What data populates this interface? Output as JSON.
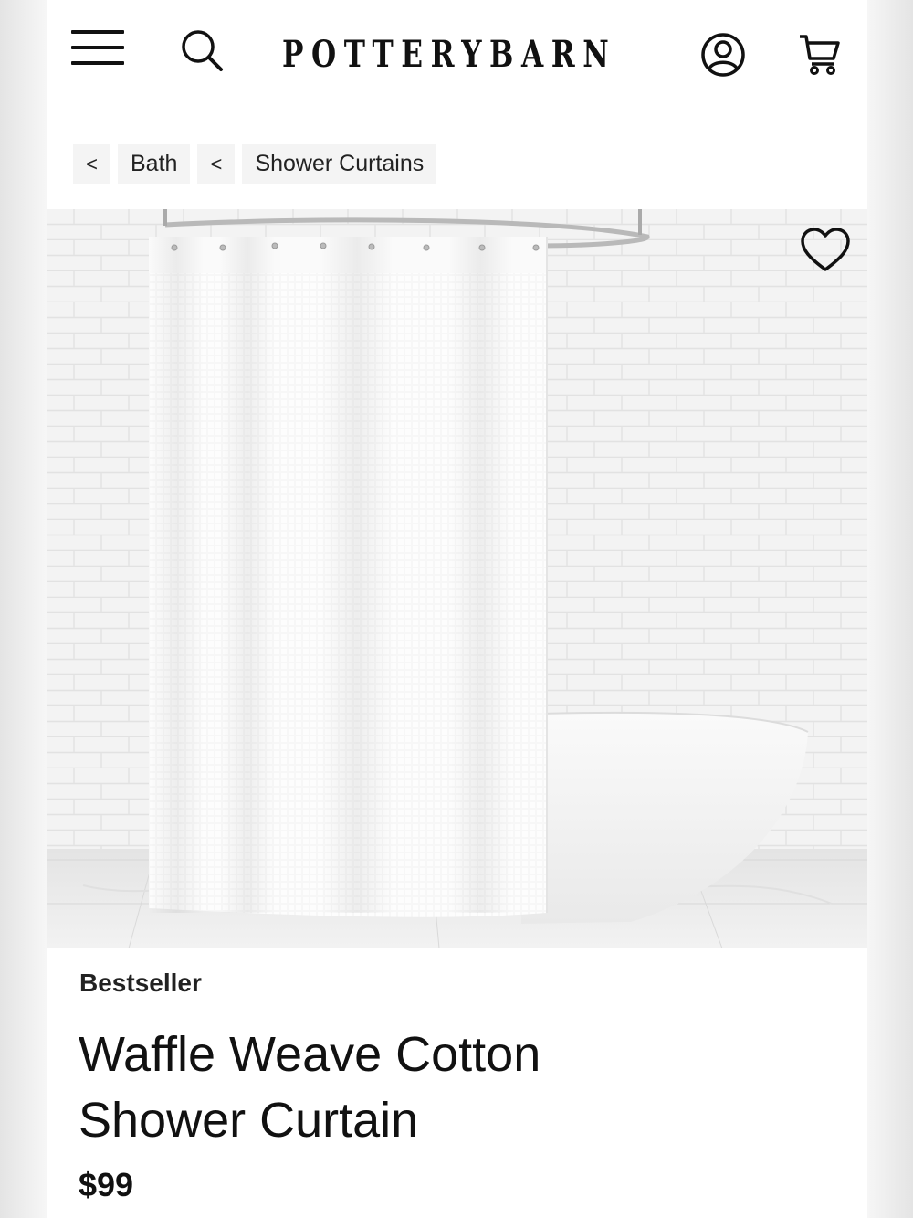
{
  "header": {
    "logo": "POTTERYBARN",
    "icons": [
      "menu-icon",
      "search-icon",
      "account-icon",
      "cart-icon"
    ]
  },
  "breadcrumb": {
    "items": [
      {
        "chevron": "<",
        "label": "Bath"
      },
      {
        "chevron": "<",
        "label": "Shower Curtains"
      }
    ]
  },
  "hero": {
    "favorite_icon": "heart-icon"
  },
  "product": {
    "badge": "Bestseller",
    "title_line1": "Waffle Weave Cotton",
    "title_line2": "Shower Curtain",
    "price": "$99"
  },
  "colors": {
    "text": "#111111",
    "crumb_bg": "#f4f4f4",
    "wall": "#f2f2f2"
  }
}
